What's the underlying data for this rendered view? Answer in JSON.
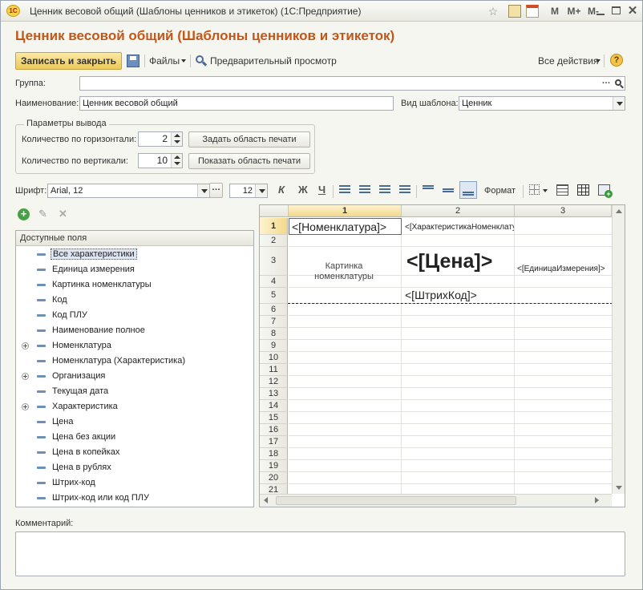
{
  "window": {
    "title": "Ценник весовой общий (Шаблоны ценников и этикеток)  (1С:Предприятие)",
    "app_icon_label": "1С",
    "memory_buttons": [
      "M",
      "M+",
      "M-"
    ]
  },
  "heading": "Ценник весовой общий (Шаблоны ценников и этикеток)",
  "toolbar": {
    "save_close": "Записать и закрыть",
    "files": "Файлы",
    "preview": "Предварительный просмотр",
    "all_actions": "Все действия",
    "help": "?"
  },
  "form": {
    "group_label": "Группа:",
    "group_value": "",
    "name_label": "Наименование:",
    "name_value": "Ценник весовой общий",
    "template_type_label": "Вид шаблона:",
    "template_type_value": "Ценник"
  },
  "output_params": {
    "legend": "Параметры вывода",
    "horizontal_label": "Количество по горизонтали:",
    "horizontal_value": "2",
    "vertical_label": "Количество по вертикали:",
    "vertical_value": "10",
    "set_area": "Задать область печати",
    "show_area": "Показать область печати"
  },
  "font_bar": {
    "font_label": "Шрифт:",
    "font_value": "Arial, 12",
    "size_value": "12",
    "bold": "Ж",
    "italic": "К",
    "underline": "Ч",
    "format": "Формат"
  },
  "fields_panel": {
    "header": "Доступные поля",
    "items": [
      {
        "label": "Все характеристики",
        "expandable": false,
        "selected": true
      },
      {
        "label": "Единица измерения",
        "expandable": false
      },
      {
        "label": "Картинка номенклатуры",
        "expandable": false
      },
      {
        "label": "Код",
        "expandable": false
      },
      {
        "label": "Код ПЛУ",
        "expandable": false
      },
      {
        "label": "Наименование полное",
        "expandable": false
      },
      {
        "label": "Номенклатура",
        "expandable": true
      },
      {
        "label": "Номенклатура (Характеристика)",
        "expandable": false
      },
      {
        "label": "Организация",
        "expandable": true
      },
      {
        "label": "Текущая дата",
        "expandable": false
      },
      {
        "label": "Характеристика",
        "expandable": true
      },
      {
        "label": "Цена",
        "expandable": false
      },
      {
        "label": "Цена без акции",
        "expandable": false
      },
      {
        "label": "Цена в копейках",
        "expandable": false
      },
      {
        "label": "Цена в рублях",
        "expandable": false
      },
      {
        "label": "Штрих-код",
        "expandable": false
      },
      {
        "label": "Штрих-код или код ПЛУ",
        "expandable": false
      }
    ]
  },
  "sheet": {
    "columns": [
      "1",
      "2",
      "3"
    ],
    "rows": [
      "1",
      "2",
      "3",
      "4",
      "5",
      "6",
      "7",
      "8",
      "9",
      "10",
      "11",
      "12",
      "13",
      "14",
      "15",
      "16",
      "17",
      "18",
      "19",
      "20",
      "21"
    ],
    "cells": {
      "nomenclature": "<[Номенклатура]>",
      "characteristic": "<[ХарактеристикаНоменклатуры]>",
      "picture": "Картинка номенклатуры",
      "price": "<[Цена]>",
      "unit": "<[ЕдиницаИзмерения]>",
      "barcode": "<[ШтрихКод]>"
    }
  },
  "comment": {
    "label": "Комментарий:",
    "value": ""
  }
}
